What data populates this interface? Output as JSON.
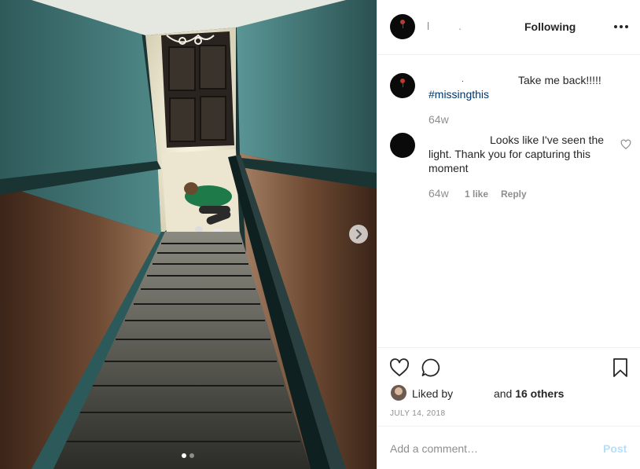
{
  "header": {
    "username_stub": "l",
    "username_dot": "˛",
    "follow_status": "Following",
    "more_icon": "more-horizontal-icon"
  },
  "caption": {
    "username_stub": ".",
    "text": "Take me back!!!!!",
    "hashtag": "#missingthis",
    "age": "64w"
  },
  "comment": {
    "text_line1": "Looks like I've seen the",
    "text_line2": "light. Thank you for capturing this",
    "text_line3": "moment",
    "age": "64w",
    "likes": "1 like",
    "reply_label": "Reply"
  },
  "likes": {
    "liked_by_label": "Liked by",
    "liked_by_user": "",
    "and_label": "and",
    "others_count": "16 others"
  },
  "date": "JULY 14, 2018",
  "add_comment": {
    "placeholder": "Add a comment…",
    "post_label": "Post"
  },
  "carousel": {
    "current_slide": 1,
    "total_slides": 2
  },
  "colors": {
    "hashtag": "#003569",
    "post_disabled": "#b2dffc",
    "muted": "#8e8e8e"
  }
}
